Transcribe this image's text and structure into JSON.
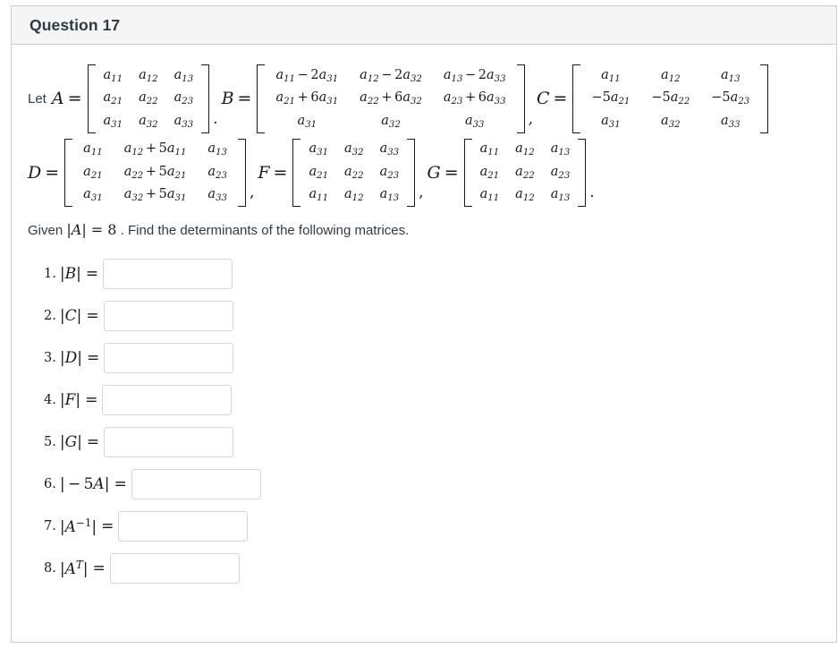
{
  "header": {
    "title": "Question 17"
  },
  "problem": {
    "lead_text": "Let",
    "given_text_before": "Given",
    "given_determinant": "|A| = 8",
    "given_text_after": ". Find the determinants of the following matrices.",
    "separator_dot": ".",
    "comma_separator": ",",
    "trailing_dot": "."
  },
  "matrices": [
    {
      "name": "A",
      "label": "A",
      "rows": [
        [
          "a11",
          "a12",
          "a13"
        ],
        [
          "a21",
          "a22",
          "a23"
        ],
        [
          "a31",
          "a32",
          "a33"
        ]
      ]
    },
    {
      "name": "B",
      "label": "B",
      "rows": [
        [
          "a11 − 2a31",
          "a12 − 2a32",
          "a13 − 2a33"
        ],
        [
          "a21 + 6a31",
          "a22 + 6a32",
          "a23 + 6a33"
        ],
        [
          "a31",
          "a32",
          "a33"
        ]
      ]
    },
    {
      "name": "C",
      "label": "C",
      "rows": [
        [
          "a11",
          "a12",
          "a13"
        ],
        [
          "−5a21",
          "−5a22",
          "−5a23"
        ],
        [
          "a31",
          "a32",
          "a33"
        ]
      ]
    },
    {
      "name": "D",
      "label": "D",
      "rows": [
        [
          "a11",
          "a12 + 5a11",
          "a13"
        ],
        [
          "a21",
          "a22 + 5a21",
          "a23"
        ],
        [
          "a31",
          "a32 + 5a31",
          "a33"
        ]
      ]
    },
    {
      "name": "F",
      "label": "F",
      "rows": [
        [
          "a31",
          "a32",
          "a33"
        ],
        [
          "a21",
          "a22",
          "a23"
        ],
        [
          "a11",
          "a12",
          "a13"
        ]
      ]
    },
    {
      "name": "G",
      "label": "G",
      "rows": [
        [
          "a11",
          "a12",
          "a13"
        ],
        [
          "a21",
          "a22",
          "a23"
        ],
        [
          "a11",
          "a12",
          "a13"
        ]
      ]
    }
  ],
  "answers": [
    {
      "number": "1.",
      "expression": "|B|",
      "value": "",
      "placeholder": ""
    },
    {
      "number": "2.",
      "expression": "|C|",
      "value": "",
      "placeholder": ""
    },
    {
      "number": "3.",
      "expression": "|D|",
      "value": "",
      "placeholder": ""
    },
    {
      "number": "4.",
      "expression": "|F|",
      "value": "",
      "placeholder": ""
    },
    {
      "number": "5.",
      "expression": "|G|",
      "value": "",
      "placeholder": ""
    },
    {
      "number": "6.",
      "expression": "| − 5A|",
      "value": "",
      "placeholder": ""
    },
    {
      "number": "7.",
      "expression": "|A⁻¹|",
      "value": "",
      "placeholder": ""
    },
    {
      "number": "8.",
      "expression": "|Aᵀ|",
      "value": "",
      "placeholder": ""
    }
  ],
  "equals_sign": "=",
  "colors": {
    "card_border": "#c7cdd1",
    "header_bg": "#f5f5f5",
    "title": "#2d3b45",
    "text": "#2d3b45",
    "math": "#1a1a1a",
    "input_border": "#d6d6d6"
  }
}
